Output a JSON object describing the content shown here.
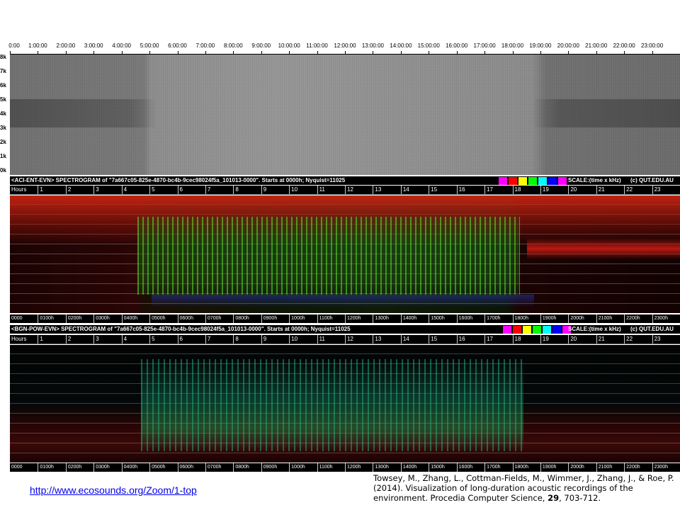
{
  "top_spectrogram": {
    "time_labels": [
      "0:00",
      "1:00:00",
      "2:00:00",
      "3:00:00",
      "4:00:00",
      "5:00:00",
      "6:00:00",
      "7:00:00",
      "8:00:00",
      "9:00:00",
      "10:00:00",
      "11:00:00",
      "12:00:00",
      "13:00:00",
      "14:00:00",
      "15:00:00",
      "16:00:00",
      "17:00:00",
      "18:00:00",
      "19:00:00",
      "20:00:00",
      "21:00:00",
      "22:00:00",
      "23:00:00"
    ],
    "freq_labels": [
      "8k",
      "7k",
      "6k",
      "5k",
      "4k",
      "3k",
      "2k",
      "1k",
      "0k"
    ]
  },
  "aci_panel": {
    "title": "<ACI-ENT-EVN> SPECTROGRAM  of \"7a667c05-825e-4870-bc4b-9cec98024f5a_101013-0000\".  Starts at 0000h; Nyquist=11025",
    "scale_label": "SCALE:(time x kHz)",
    "credit": "(c) QUT.EDU.AU",
    "hours_label": "Hours",
    "hour_numbers": [
      "1",
      "2",
      "3",
      "4",
      "5",
      "6",
      "7",
      "8",
      "9",
      "10",
      "11",
      "12",
      "13",
      "14",
      "15",
      "16",
      "17",
      "18",
      "19",
      "20",
      "21",
      "22",
      "23"
    ],
    "footer_labels": [
      "0000",
      "0100h",
      "0200h",
      "0300h",
      "0400h",
      "0500h",
      "0600h",
      "0700h",
      "0800h",
      "0900h",
      "1000h",
      "1100h",
      "1200h",
      "1300h",
      "1400h",
      "1500h",
      "1600h",
      "1700h",
      "1800h",
      "1900h",
      "2000h",
      "2100h",
      "2200h",
      "2300h"
    ],
    "swatch_colors": [
      "#ff00ff",
      "#ff0000",
      "#ffff00",
      "#00ff00",
      "#00ffff",
      "#0000ff",
      "#ff00ff"
    ]
  },
  "bgn_panel": {
    "title": "<BGN-POW-EVN> SPECTROGRAM  of \"7a667c05-825e-4870-bc4b-9cec98024f5a_101013-0000\".  Starts at 0000h; Nyquist=11025",
    "scale_label": "SCALE:(time x kHz)",
    "credit": "(c) QUT.EDU.AU",
    "hours_label": "Hours",
    "hour_numbers": [
      "1",
      "2",
      "3",
      "4",
      "5",
      "6",
      "7",
      "8",
      "9",
      "10",
      "11",
      "12",
      "13",
      "14",
      "15",
      "16",
      "17",
      "18",
      "19",
      "20",
      "21",
      "22",
      "23"
    ],
    "footer_labels": [
      "0000",
      "0100h",
      "0200h",
      "0300h",
      "0400h",
      "0500h",
      "0600h",
      "0700h",
      "0800h",
      "0900h",
      "1000h",
      "1100h",
      "1200h",
      "1300h",
      "1400h",
      "1500h",
      "1600h",
      "1700h",
      "1800h",
      "1900h",
      "2000h",
      "2100h",
      "2200h",
      "2300h"
    ],
    "swatch_colors": [
      "#ff00ff",
      "#ff0000",
      "#ffff00",
      "#00ff00",
      "#00ffff",
      "#0000ff",
      "#ff00ff"
    ]
  },
  "link": {
    "text": "http://www.ecosounds.org/Zoom/1-top"
  },
  "citation": {
    "prefix": "Towsey, M., Zhang, L., Cottman-Fields, M., Wimmer, J., Zhang, J., & Roe, P. (2014). Visualization of long-duration acoustic recordings of the environment. Procedia Computer Science, ",
    "volume": "29",
    "suffix": ", 703-712."
  }
}
